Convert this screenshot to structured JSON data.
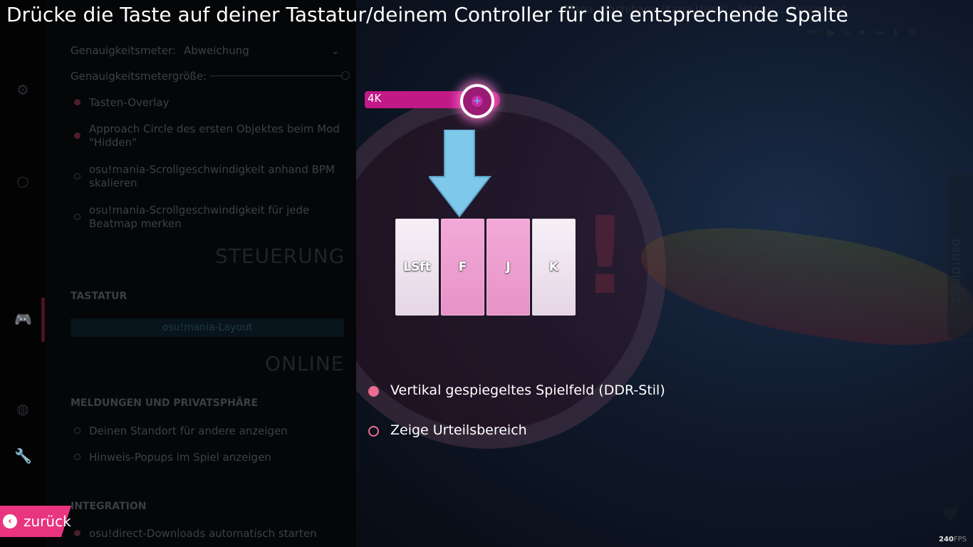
{
  "instruction": "Drücke die Taste auf deiner Tastatur/deinem Controller für die entsprechende Spalte",
  "keycount": {
    "label": "4K",
    "value_keys": 4
  },
  "columns": [
    {
      "key": "LSft",
      "style": "white"
    },
    {
      "key": "F",
      "style": "pink"
    },
    {
      "key": "J",
      "style": "pink"
    },
    {
      "key": "K",
      "style": "white"
    }
  ],
  "options": [
    {
      "label": "Vertikal gespiegeltes Spielfeld (DDR-Stil)",
      "checked": true
    },
    {
      "label": "Zeige Urteilsbereich",
      "checked": false
    }
  ],
  "back_button": {
    "label": "zurück"
  },
  "fps": {
    "value": "240",
    "unit": "FPS"
  },
  "background_settings": {
    "accuracy_meter_label": "Genauigkeitsmeter:",
    "accuracy_meter_value": "Abweichung",
    "accuracy_meter_size_label": "Genauigkeitsmetergröße:",
    "items": [
      "Tasten-Overlay",
      "Approach Circle des ersten Objektes beim Mod \"Hidden\"",
      "osu!mania-Scrollgeschwindigkeit anhand BPM skalieren",
      "osu!mania-Scrollgeschwindigkeit für jede Beatmap merken"
    ],
    "section_controls": "STEUERUNG",
    "heading_keyboard": "TASTATUR",
    "layout_button": "osu!mania-Layout",
    "section_online": "ONLINE",
    "heading_privacy": "MELDUNGEN UND PRIVATSPHÄRE",
    "privacy_items": [
      "Deinen Standort für andere anzeigen",
      "Hinweis-Popups im Spiel anzeigen"
    ],
    "heading_integration": "INTEGRATION",
    "integration_items": [
      "osu!direct-Downloads automatisch starten"
    ]
  },
  "now_playing": "Mana - Tachibana (Kana Izumi) - Happy ... TVsize ver.",
  "side_tab_label": "osu!direct",
  "colors": {
    "accent_pink": "#e9347f",
    "keycount_bar": "#c11a86",
    "arrow_blue": "#7ec8ea",
    "option_pink": "#ec6c92"
  }
}
